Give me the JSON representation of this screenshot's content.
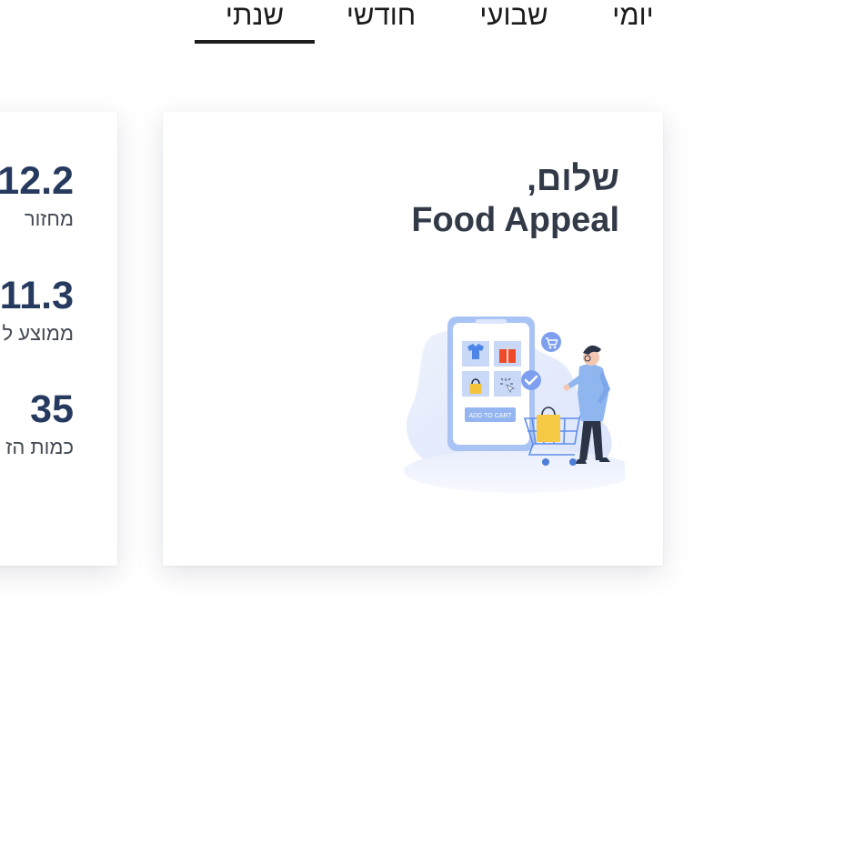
{
  "tabs": [
    {
      "id": "yearly",
      "label": "שנתי",
      "active": true
    },
    {
      "id": "monthly",
      "label": "חודשי",
      "active": false
    },
    {
      "id": "weekly",
      "label": "שבועי",
      "active": false
    },
    {
      "id": "daily",
      "label": "יומי",
      "active": false
    }
  ],
  "stats": [
    {
      "value": "12.2",
      "label": "מחזור"
    },
    {
      "value": "11.3",
      "label": "ממוצע ל"
    },
    {
      "value": "35",
      "label": "כמות הז"
    }
  ],
  "welcome": {
    "greeting": "שלום,",
    "brand": "Food Appeal",
    "illustration_button": "ADD TO CART"
  },
  "colors": {
    "accent": "#253a5e",
    "tab_indicator": "#1e1e1e",
    "illustration_blue": "#7fa6f0"
  },
  "icons": [
    "shopping-cart-icon",
    "checkmark-icon",
    "shirt-icon",
    "gift-icon",
    "bag-icon"
  ]
}
